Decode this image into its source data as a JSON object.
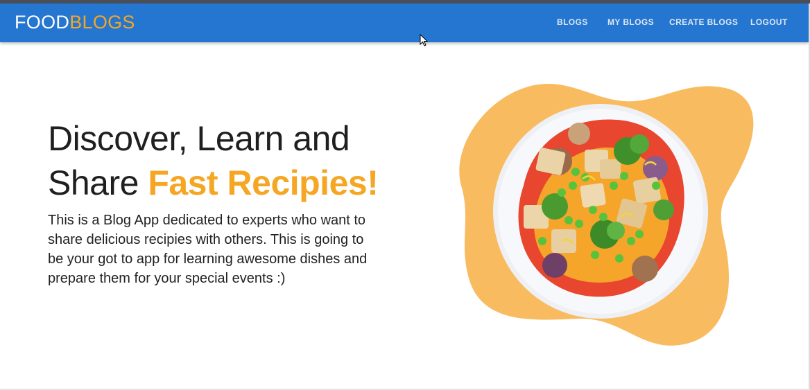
{
  "brand": {
    "part1": "FOOD",
    "part2": "BLOGS"
  },
  "nav": {
    "blogs": "BLOGS",
    "my_blogs": "MY BLOGS",
    "create_blogs": "CREATE BLOGS",
    "logout": "LOGOUT"
  },
  "hero": {
    "title_line1": "Discover, Learn and",
    "title_line2_prefix": "Share ",
    "title_highlight": "Fast Recipies!",
    "description": "This is a Blog App dedicated to experts who want to share delicious recipies with others. This is going to be your got to app for learning awesome dishes and prepare them for your special events :)"
  },
  "colors": {
    "navbar": "#2576d0",
    "accent": "#f5a623",
    "blob": "#f9bb5f"
  },
  "icons": {
    "cursor": "mouse-pointer-icon"
  }
}
